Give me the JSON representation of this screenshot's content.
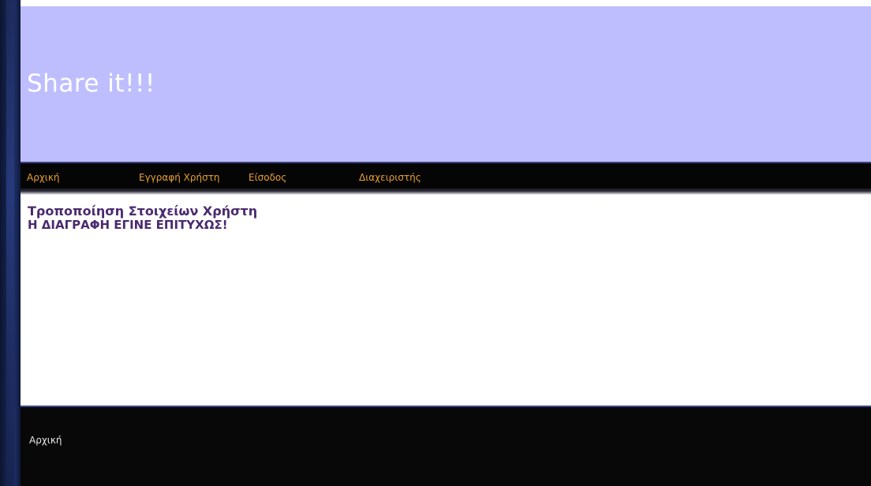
{
  "header": {
    "title": "Share it!!!",
    "background_color": "#bebeff",
    "title_color": "#ffffff"
  },
  "nav": {
    "items": [
      {
        "label": "Αρχική"
      },
      {
        "label": "Εγγραφή Χρήστη"
      },
      {
        "label": "Είσοδος"
      },
      {
        "label": "Διαχειριστής"
      }
    ],
    "link_color": "#e8a030",
    "background_color": "#050505"
  },
  "main": {
    "heading": "Τροποποίηση Στοιχείων Χρήστη",
    "message": "Η ΔΙΑΓΡΑΦΗ ΕΓΙΝΕ ΕΠΙΤΥΧΩΣ!",
    "text_color": "#4a2a6e"
  },
  "footer": {
    "links": [
      {
        "label": "Αρχική"
      }
    ],
    "background_color": "#080808"
  }
}
